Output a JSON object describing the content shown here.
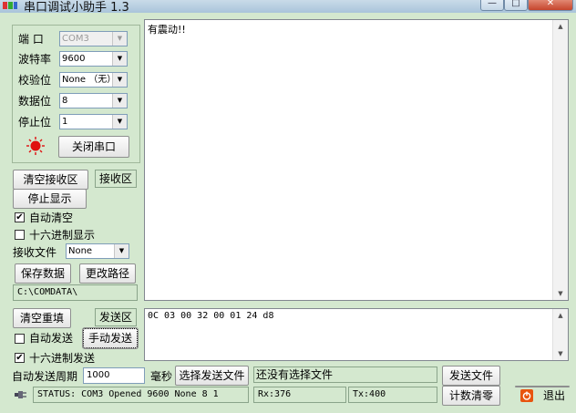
{
  "window": {
    "title": "串口调试小助手 1.3",
    "minimize": "—",
    "maximize": "□",
    "close": "✕"
  },
  "settings": {
    "port_label": "端  口",
    "port_value": "COM3",
    "baud_label": "波特率",
    "baud_value": "9600",
    "parity_label": "校验位",
    "parity_value": "None （无）",
    "databits_label": "数据位",
    "databits_value": "8",
    "stopbits_label": "停止位",
    "stopbits_value": "1",
    "toggle_port_button": "关闭串口"
  },
  "receive": {
    "clear_button": "清空接收区",
    "area_label": "接收区",
    "stop_display_button": "停止显示",
    "auto_clear_label": "自动清空",
    "auto_clear_checked": true,
    "hex_display_label": "十六进制显示",
    "hex_display_checked": false,
    "file_label": "接收文件",
    "file_type_value": "None",
    "save_button": "保存数据",
    "change_path_button": "更改路径",
    "path_value": "C:\\COMDATA\\",
    "content": "有震动!!"
  },
  "send": {
    "clear_button": "清空重填",
    "area_label": "发送区",
    "auto_send_label": "自动发送",
    "auto_send_checked": false,
    "manual_send_button": "手动发送",
    "hex_send_label": "十六进制发送",
    "hex_send_checked": true,
    "content": "0C 03 00 32 00 01 24 d8",
    "period_label": "自动发送周期",
    "period_value": "1000",
    "period_unit": "毫秒",
    "choose_file_button": "选择发送文件",
    "file_status": "还没有选择文件",
    "send_file_button": "发送文件",
    "clear_count_button": "计数清零",
    "exit_button": "退出"
  },
  "status": {
    "text": "STATUS: COM3 Opened 9600 None  8 1",
    "rx": "Rx:376",
    "tx": "Tx:400"
  },
  "colors": {
    "background": "#d4e8cf",
    "indicator": "#e01010"
  }
}
